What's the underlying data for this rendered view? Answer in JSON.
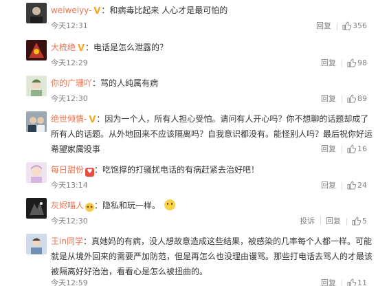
{
  "comments": [
    {
      "username": "weiweiyy-",
      "badges": [
        "V"
      ],
      "text": "和病毒比起来 人心才是最可怕的",
      "time": "今天12:31",
      "reply_label": "回复",
      "likes": "356",
      "avatar_color": "#3b3b3b"
    },
    {
      "username": "大梳绝",
      "badges": [
        "V"
      ],
      "text": "电话是怎么泄露的？",
      "time": "今天12:29",
      "reply_label": "回复",
      "likes": "98",
      "avatar_color": "#7a1f1f"
    },
    {
      "username": "你的广珊吖",
      "badges": [],
      "text": "骂的人纯属有病",
      "time": "今天12:30",
      "reply_label": "回复",
      "likes": "89",
      "avatar_color": "#8fb28a"
    },
    {
      "username": "绝世倾情-",
      "badges": [
        "V"
      ],
      "text": "因为一个人，所有人担心受怕。请问有人开心吗？你不想聊的话题却成了所有人的话题。从外地回来不应该隔离吗？自我意识都没有。能怪别人吗？最后祝你好运希望家属没事",
      "time": "今天12:29",
      "reply_label": "回复",
      "likes": "16",
      "avatar_color": "#556677"
    },
    {
      "username": "每日甜份",
      "badges": [
        "heart"
      ],
      "text": "吃饱撑的打骚扰电话的有病赶紧去治好吧！",
      "time": "今天13:14",
      "reply_label": "回复",
      "likes": "24",
      "avatar_color": "#c9a9d6"
    },
    {
      "username": "灰烬喵人",
      "badges": [
        "emoji"
      ],
      "text": "隐私和玩一样。",
      "time": "今天12:30",
      "report_label": "投诉",
      "reply_label": "回复",
      "likes": "5",
      "has_sticker": true,
      "avatar_color": "#2b2b2b"
    },
    {
      "username": "王in同学",
      "badges": [],
      "text": "真她妈的有病，没人想故意造成这些结果，被感染的几率每个人都一样。可能就是从境外回来的需要严加防范，但是再怎么也没理由谩骂。那些打电话去骂人的才最该被隔离好好治治，看看心是怎么被扭曲的。",
      "time": "今天12:59",
      "reply_label": "回复",
      "likes": "11",
      "avatar_color": "#6f8fb5"
    }
  ]
}
